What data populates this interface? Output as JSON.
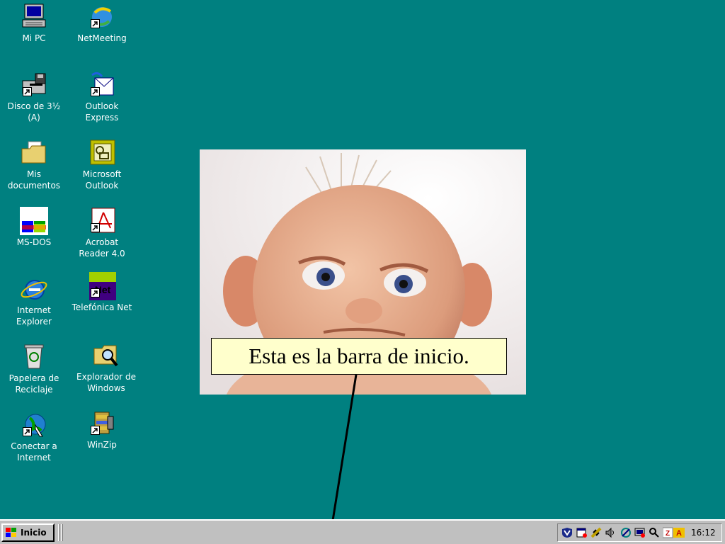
{
  "desktop": {
    "background": "#008080",
    "icons": [
      {
        "label": "Mi PC",
        "icon": "my-computer-icon"
      },
      {
        "label": "NetMeeting",
        "icon": "netmeeting-icon"
      },
      {
        "label": "Disco de 3½\n(A)",
        "icon": "floppy-drive-icon"
      },
      {
        "label": "Outlook\nExpress",
        "icon": "outlook-express-icon"
      },
      {
        "label": "Mis\ndocumentos",
        "icon": "my-documents-icon"
      },
      {
        "label": "Microsoft\nOutlook",
        "icon": "microsoft-outlook-icon"
      },
      {
        "label": "MS-DOS",
        "icon": "ms-dos-icon"
      },
      {
        "label": "Acrobat\nReader 4.0",
        "icon": "acrobat-reader-icon"
      },
      {
        "label": "Internet\nExplorer",
        "icon": "internet-explorer-icon"
      },
      {
        "label": "Telefónica Net",
        "icon": "telefonica-net-icon"
      },
      {
        "label": "Papelera de\nReciclaje",
        "icon": "recycle-bin-icon"
      },
      {
        "label": "Explorador de\nWindows",
        "icon": "windows-explorer-icon"
      },
      {
        "label": "Conectar a\nInternet",
        "icon": "connect-to-internet-icon"
      },
      {
        "label": "WinZip",
        "icon": "winzip-icon"
      }
    ]
  },
  "callout": {
    "text": "Esta es la barra de inicio.",
    "background": "#ffffcc"
  },
  "taskbar": {
    "start_label": "Inicio",
    "clock": "16:12",
    "tray_icons": [
      "antivirus-shield-icon",
      "calendar-icon",
      "network-plug-icon",
      "volume-icon",
      "connection-icon",
      "monitor-icon",
      "search-icon",
      "zonealarm-icon"
    ]
  }
}
